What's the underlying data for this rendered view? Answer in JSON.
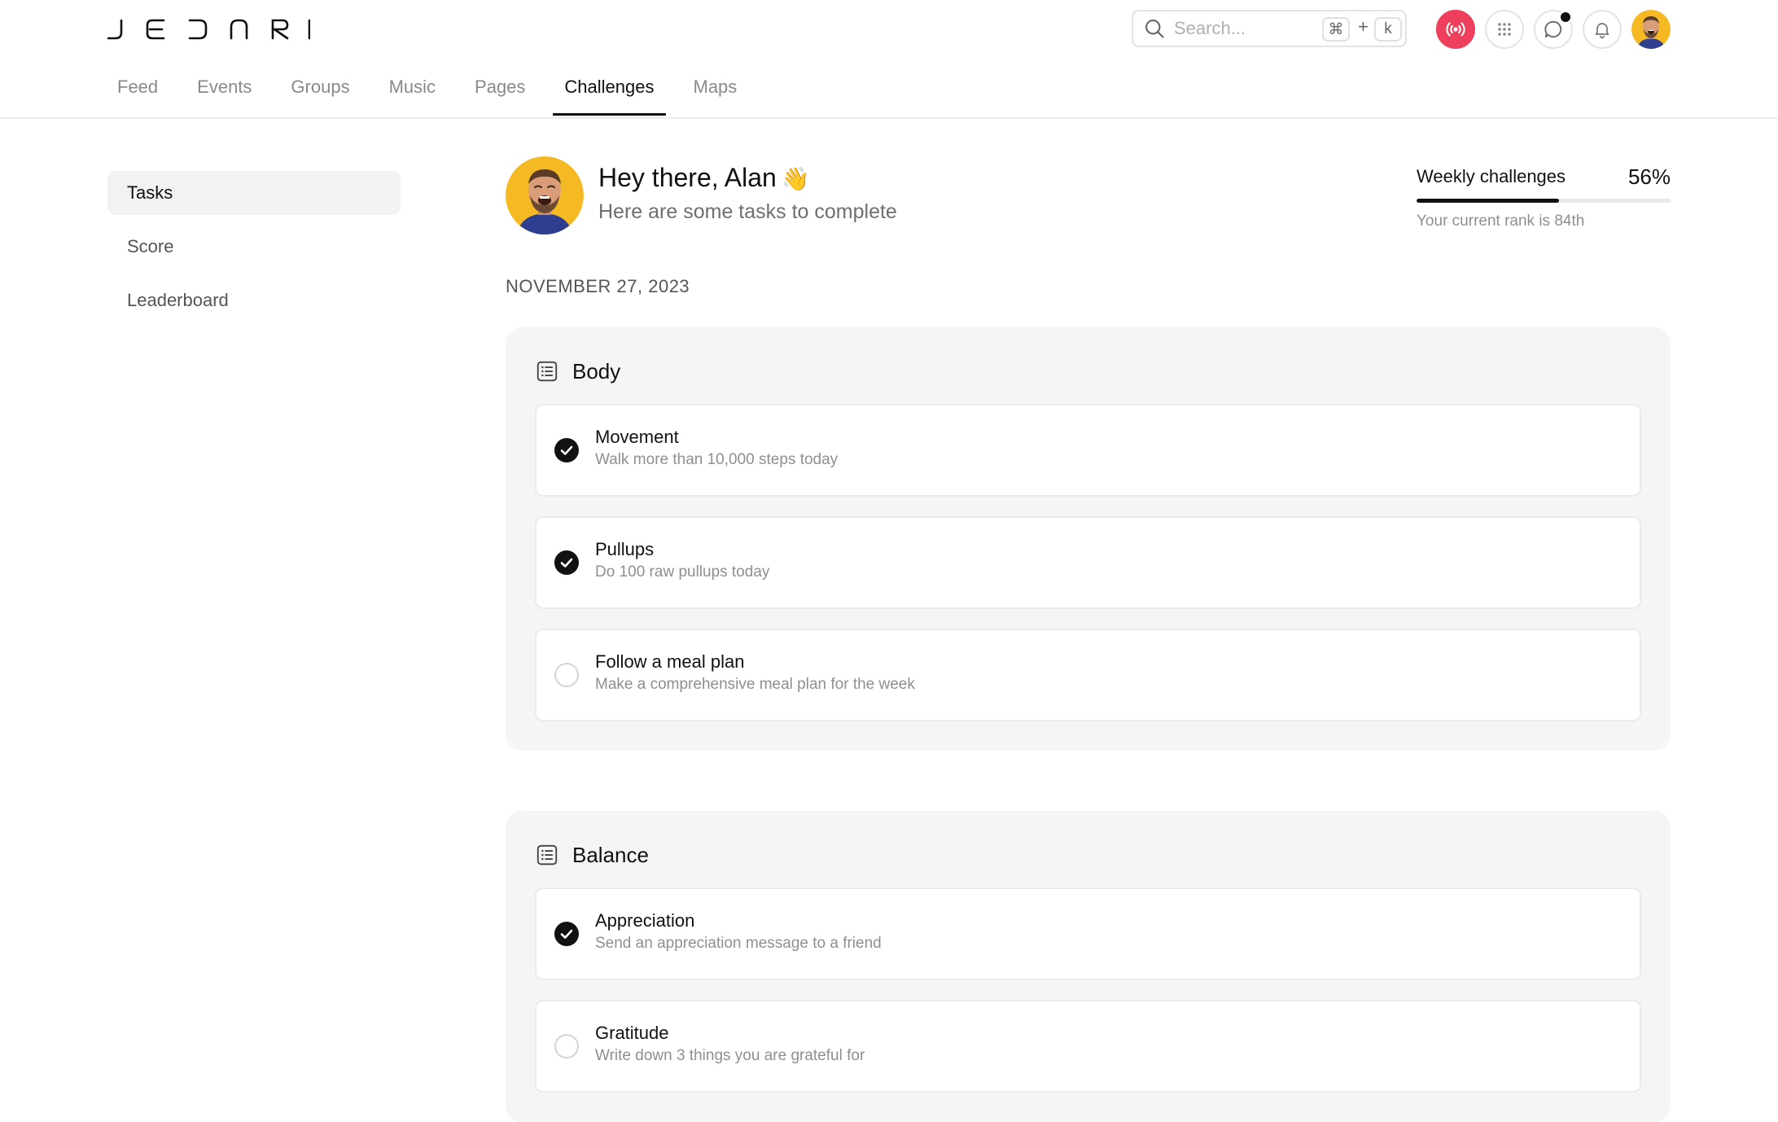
{
  "brand": {
    "logo_text": "JEDNRI"
  },
  "search": {
    "placeholder": "Search...",
    "shortcut_key1": "⌘",
    "shortcut_plus": "+",
    "shortcut_key2": "k"
  },
  "header_icons": [
    "live-broadcast-icon",
    "apps-grid-icon",
    "chat-icon",
    "bell-icon"
  ],
  "colors": {
    "live_accent": "#ee3f5c",
    "active_text": "#111111",
    "muted_text": "#8a8a8a"
  },
  "tabs": [
    {
      "label": "Feed",
      "active": false
    },
    {
      "label": "Events",
      "active": false
    },
    {
      "label": "Groups",
      "active": false
    },
    {
      "label": "Music",
      "active": false
    },
    {
      "label": "Pages",
      "active": false
    },
    {
      "label": "Challenges",
      "active": true
    },
    {
      "label": "Maps",
      "active": false
    }
  ],
  "sidebar": {
    "items": [
      {
        "label": "Tasks",
        "active": true
      },
      {
        "label": "Score",
        "active": false
      },
      {
        "label": "Leaderboard",
        "active": false
      }
    ]
  },
  "greeting": {
    "title": "Hey there, Alan",
    "emoji": "👋",
    "subtitle": "Here are some tasks to complete"
  },
  "weekly": {
    "title": "Weekly challenges",
    "percent_label": "56%",
    "progress": 0.56,
    "rank_text": "Your current rank is 84th"
  },
  "date": "NOVEMBER 27, 2023",
  "sections": [
    {
      "title": "Body",
      "tasks": [
        {
          "title": "Movement",
          "desc": "Walk more than 10,000 steps today",
          "done": true
        },
        {
          "title": "Pullups",
          "desc": "Do 100 raw pullups today",
          "done": true
        },
        {
          "title": "Follow a meal plan",
          "desc": "Make a comprehensive meal plan for the week",
          "done": false
        }
      ]
    },
    {
      "title": "Balance",
      "tasks": [
        {
          "title": "Appreciation",
          "desc": "Send an appreciation message to a friend",
          "done": true
        },
        {
          "title": "Gratitude",
          "desc": "Write down 3 things you are grateful for",
          "done": false
        }
      ]
    }
  ]
}
